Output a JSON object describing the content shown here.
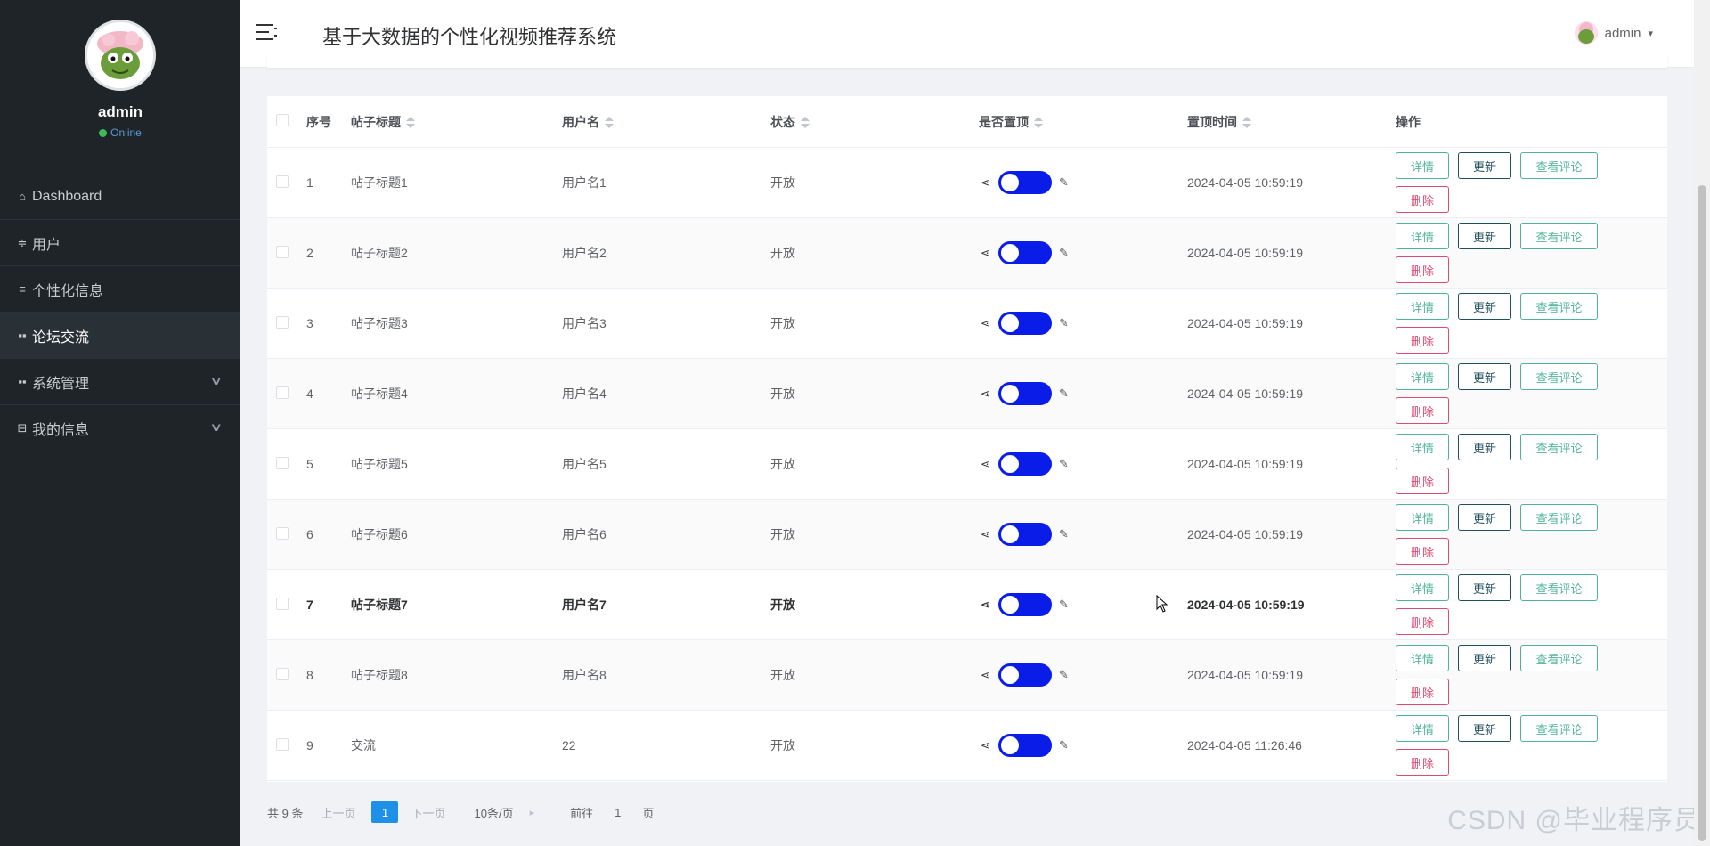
{
  "sidebar": {
    "user_name": "admin",
    "status": "Online",
    "items": [
      {
        "label": "Dashboard",
        "icon": "home-icon"
      },
      {
        "label": "用户",
        "icon": "sliders-icon"
      },
      {
        "label": "个性化信息",
        "icon": "list-icon"
      },
      {
        "label": "论坛交流",
        "icon": "grid-icon",
        "active": true
      },
      {
        "label": "系统管理",
        "icon": "grid-icon",
        "expandable": true
      },
      {
        "label": "我的信息",
        "icon": "card-icon",
        "expandable": true
      }
    ]
  },
  "header": {
    "title": "基于大数据的个性化视频推荐系统",
    "user": "admin"
  },
  "table": {
    "columns": [
      "序号",
      "帖子标题",
      "用户名",
      "状态",
      "是否置顶",
      "置顶时间",
      "操作"
    ],
    "rows": [
      {
        "no": "1",
        "title": "帖子标题1",
        "user": "用户名1",
        "status": "开放",
        "time": "2024-04-05 10:59:19"
      },
      {
        "no": "2",
        "title": "帖子标题2",
        "user": "用户名2",
        "status": "开放",
        "time": "2024-04-05 10:59:19"
      },
      {
        "no": "3",
        "title": "帖子标题3",
        "user": "用户名3",
        "status": "开放",
        "time": "2024-04-05 10:59:19"
      },
      {
        "no": "4",
        "title": "帖子标题4",
        "user": "用户名4",
        "status": "开放",
        "time": "2024-04-05 10:59:19"
      },
      {
        "no": "5",
        "title": "帖子标题5",
        "user": "用户名5",
        "status": "开放",
        "time": "2024-04-05 10:59:19"
      },
      {
        "no": "6",
        "title": "帖子标题6",
        "user": "用户名6",
        "status": "开放",
        "time": "2024-04-05 10:59:19"
      },
      {
        "no": "7",
        "title": "帖子标题7",
        "user": "用户名7",
        "status": "开放",
        "time": "2024-04-05 10:59:19"
      },
      {
        "no": "8",
        "title": "帖子标题8",
        "user": "用户名8",
        "status": "开放",
        "time": "2024-04-05 10:59:19"
      },
      {
        "no": "9",
        "title": "交流",
        "user": "22",
        "status": "开放",
        "time": "2024-04-05 11:26:46"
      }
    ],
    "buttons": {
      "detail": "详情",
      "update": "更新",
      "comment": "查看评论",
      "delete": "删除"
    }
  },
  "pagination": {
    "total": "共 9 条",
    "prev": "上一页",
    "current": "1",
    "next": "下一页",
    "page_size": "10条/页",
    "goto": "前往",
    "goto_value": "1",
    "page_suffix": "页"
  },
  "watermark": "CSDN @毕业程序员",
  "colors": {
    "sidebar_bg": "#1e2428",
    "switch_on": "#0a1ce8",
    "detail": "#4fb39a",
    "update": "#1f4f5c",
    "delete": "#e04a6f",
    "page_active": "#1f90e8"
  }
}
